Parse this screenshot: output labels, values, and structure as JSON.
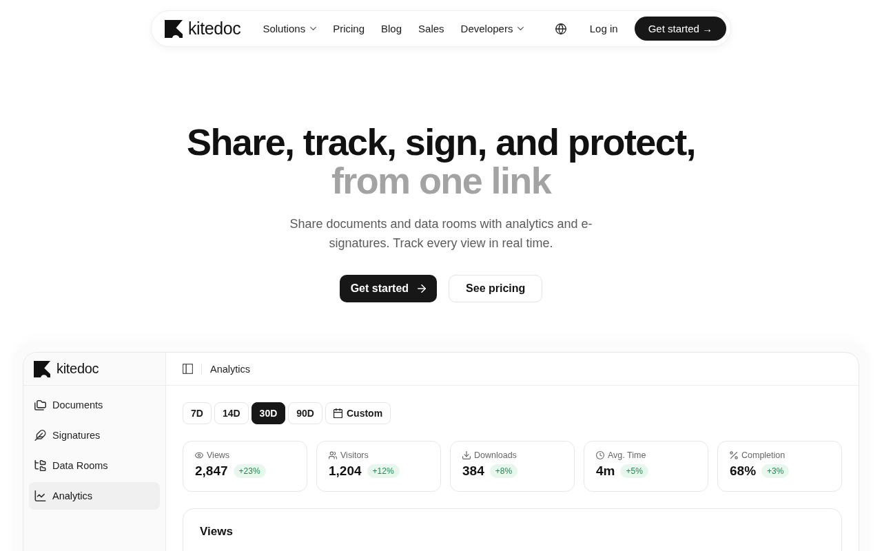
{
  "nav": {
    "logo": "kitedoc",
    "links": [
      {
        "label": "Solutions",
        "dropdown": true
      },
      {
        "label": "Pricing",
        "dropdown": false
      },
      {
        "label": "Blog",
        "dropdown": false
      },
      {
        "label": "Sales",
        "dropdown": false
      },
      {
        "label": "Developers",
        "dropdown": true
      }
    ],
    "login": "Log in",
    "cta": "Get started →"
  },
  "hero": {
    "title": "Share, track, sign, and protect,",
    "title_muted": "from one link",
    "subtitle": "Share documents and data rooms with analytics and e-signatures. Track every view in real time.",
    "primary_button": "Get started",
    "secondary_button": "See pricing"
  },
  "dashboard": {
    "sidebar": {
      "logo": "kitedoc",
      "items": [
        {
          "label": "Documents",
          "selected": false
        },
        {
          "label": "Signatures",
          "selected": false
        },
        {
          "label": "Data Rooms",
          "selected": false
        },
        {
          "label": "Analytics",
          "selected": true
        }
      ]
    },
    "header": {
      "title": "Analytics"
    },
    "ranges": [
      {
        "kind": "preset",
        "label": "7D",
        "selected": false
      },
      {
        "kind": "preset",
        "label": "14D",
        "selected": false
      },
      {
        "kind": "preset",
        "label": "30D",
        "selected": true
      },
      {
        "kind": "preset",
        "label": "90D",
        "selected": false
      },
      {
        "kind": "date_picker",
        "label": "Custom",
        "selected": false
      }
    ],
    "stats": [
      {
        "label": "Views",
        "value": "2,847",
        "change": "+23%"
      },
      {
        "label": "Visitors",
        "value": "1,204",
        "change": "+12%"
      },
      {
        "label": "Downloads",
        "value": "384",
        "change": "+8%"
      },
      {
        "label": "Avg. Time",
        "value": "4m",
        "change": "+5%"
      },
      {
        "label": "Completion",
        "value": "68%",
        "change": "+3%"
      }
    ],
    "chart": {
      "title": "Views"
    }
  }
}
